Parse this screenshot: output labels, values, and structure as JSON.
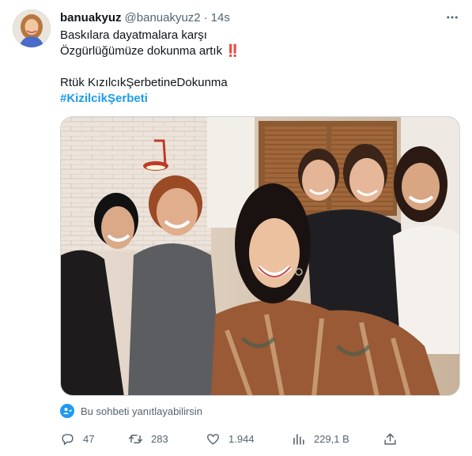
{
  "author": {
    "display_name": "banuakyuz",
    "handle": "@banuakyuz2",
    "separator": "·",
    "time": "14s"
  },
  "tweet": {
    "line1": "Baskılara dayatmalara karşı",
    "line2": "Özgürlüğümüze dokunma artık",
    "line2_emoji": "‼️",
    "line3": "Rtük KızılcıkŞerbetineDokunma",
    "hashtag": "#KizilcikŞerbeti"
  },
  "reply_restriction": {
    "text": "Bu sohbeti yanıtlayabilirsin"
  },
  "actions": {
    "replies": "47",
    "retweets": "283",
    "likes": "1.944",
    "views": "229,1 B"
  },
  "colors": {
    "accent": "#1d9bf0",
    "muted": "#536471",
    "text": "#0f1419",
    "alert": "#e0245e"
  },
  "icons": {
    "more": "more-dots-icon",
    "reply": "reply-icon",
    "retweet": "retweet-icon",
    "like": "heart-icon",
    "views": "views-chart-icon",
    "share": "share-icon",
    "restriction": "people-icon"
  }
}
